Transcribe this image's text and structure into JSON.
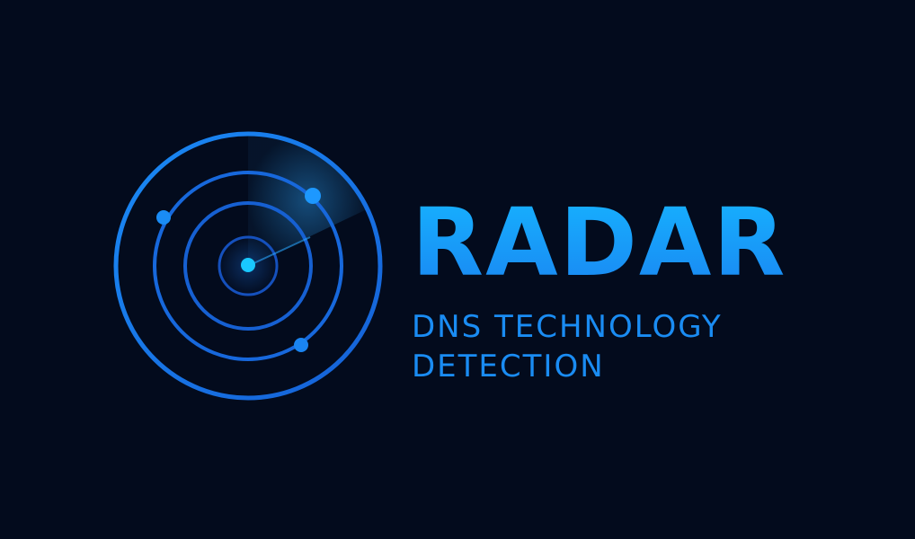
{
  "brand": {
    "title": "RADAR",
    "subtitle_line1": "DNS TECHNOLOGY",
    "subtitle_line2": "DETECTION"
  },
  "colors": {
    "background": "#030b1d",
    "title_gradient_top": "#16b3ff",
    "title_gradient_bottom": "#1a86f2",
    "subtitle": "#1a8cf3",
    "ring_outer": "#1a7ff0",
    "ring_inner": "#1764d8",
    "blip": "#1ea0ff",
    "center_dot": "#19c8ff"
  },
  "icons": {
    "logo": "radar-scope-icon"
  }
}
